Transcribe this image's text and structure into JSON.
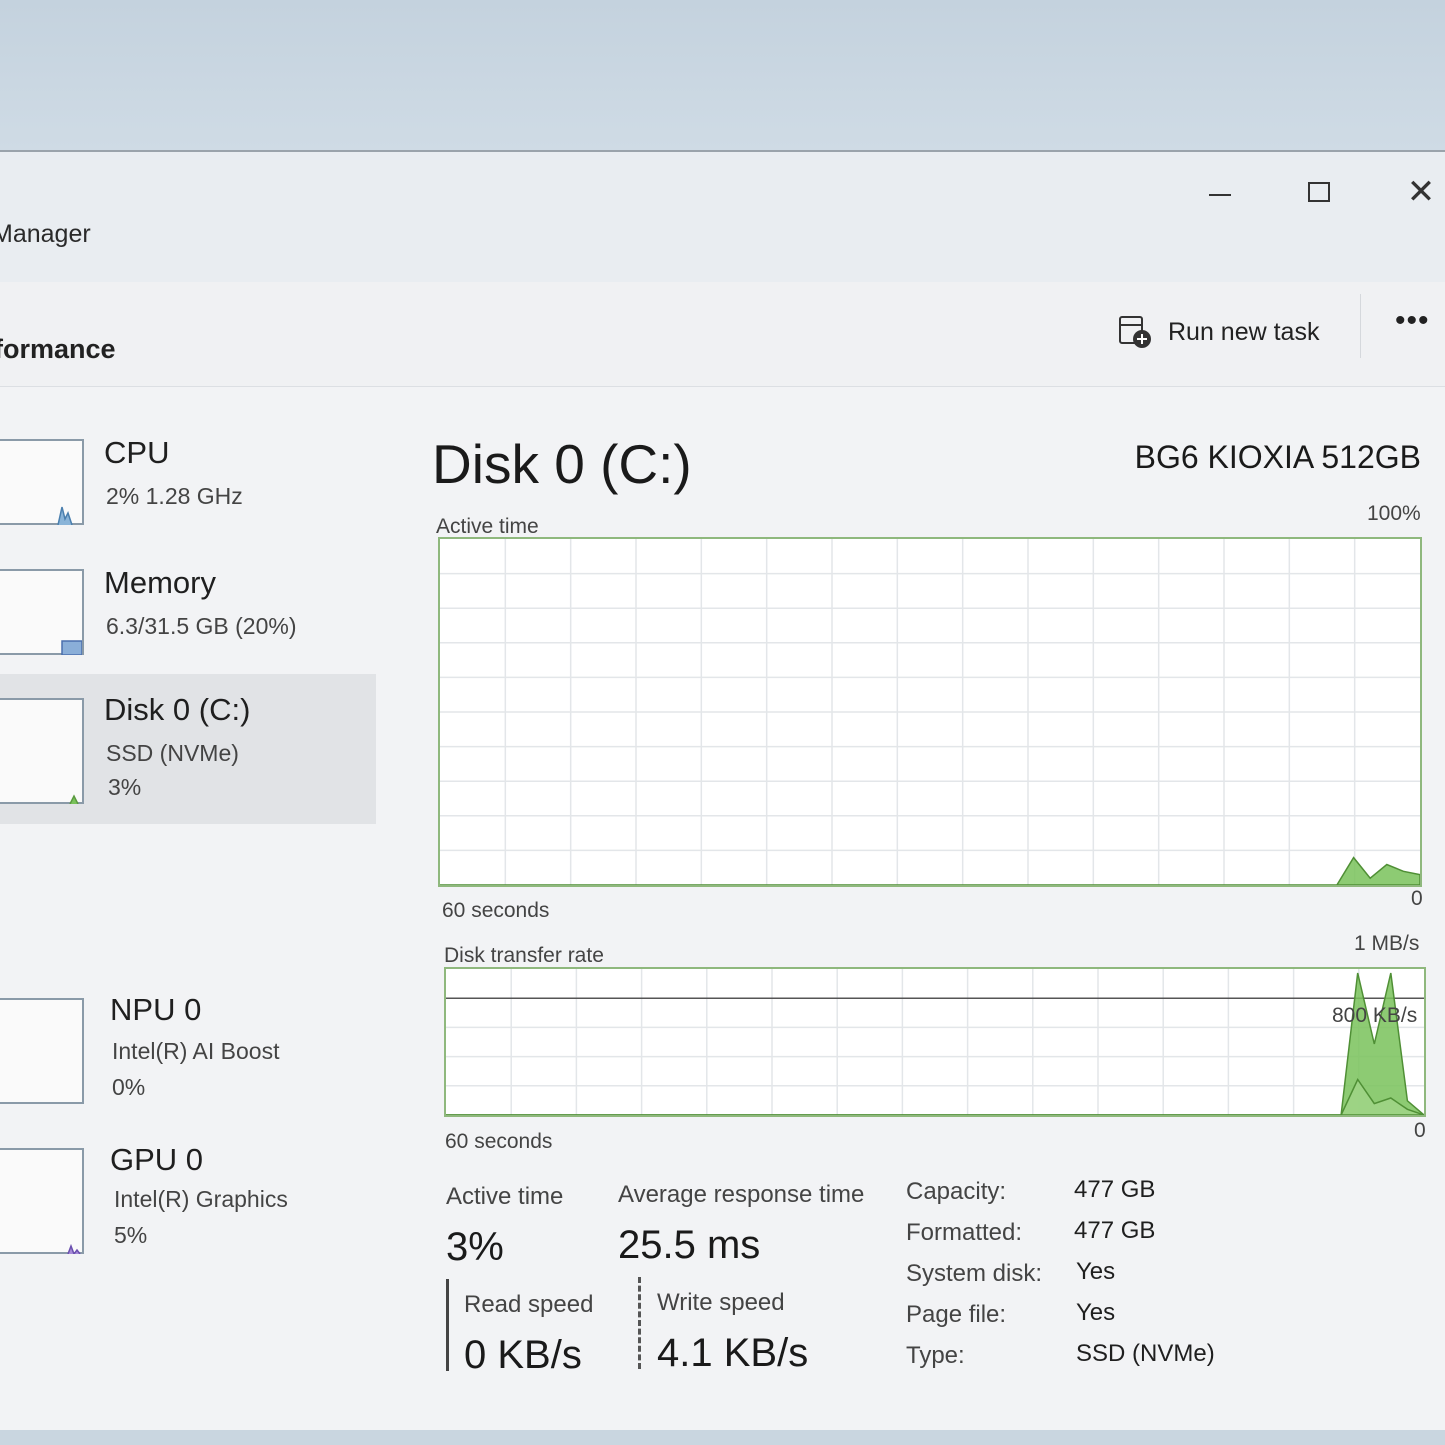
{
  "window": {
    "title": "Manager"
  },
  "header": {
    "page_title": "formance",
    "run_new_task_label": "Run new task",
    "more_label": "•••"
  },
  "sidebar": {
    "items": [
      {
        "name": "CPU",
        "sub": "2%  1.28 GHz",
        "sub2": ""
      },
      {
        "name": "Memory",
        "sub": "6.3/31.5 GB (20%)",
        "sub2": ""
      },
      {
        "name": "Disk 0 (C:)",
        "sub": "SSD (NVMe)",
        "sub2": "3%"
      },
      {
        "name": "NPU 0",
        "sub": "Intel(R) AI Boost",
        "sub2": "0%"
      },
      {
        "name": "GPU 0",
        "sub": "Intel(R) Graphics",
        "sub2": "5%"
      }
    ]
  },
  "main": {
    "title": "Disk 0 (C:)",
    "model": "BG6 KIOXIA 512GB",
    "active_graph": {
      "label": "Active time",
      "max_label": "100%",
      "time_label": "60 seconds",
      "min_label": "0"
    },
    "transfer_graph": {
      "label": "Disk transfer rate",
      "max_label": "1 MB/s",
      "mid_label": "800 KB/s",
      "time_label": "60 seconds",
      "min_label": "0"
    },
    "stats": {
      "active_time_label": "Active time",
      "active_time_value": "3%",
      "avg_response_label": "Average response time",
      "avg_response_value": "25.5 ms",
      "read_label": "Read speed",
      "read_value": "0 KB/s",
      "write_label": "Write speed",
      "write_value": "4.1 KB/s"
    },
    "properties": [
      {
        "key": "Capacity:",
        "value": "477 GB"
      },
      {
        "key": "Formatted:",
        "value": "477 GB"
      },
      {
        "key": "System disk:",
        "value": "Yes"
      },
      {
        "key": "Page file:",
        "value": "Yes"
      },
      {
        "key": "Type:",
        "value": "SSD (NVMe)"
      }
    ]
  },
  "chart_data": [
    {
      "type": "area",
      "title": "Active time",
      "ylim": [
        0,
        100
      ],
      "unit": "%",
      "x_span": "60 seconds",
      "series": [
        {
          "values": [
            0,
            0,
            0,
            0,
            0,
            0,
            0,
            0,
            0,
            0,
            0,
            0,
            0,
            0,
            0,
            0,
            0,
            0,
            0,
            0,
            0,
            0,
            0,
            0,
            0,
            0,
            0,
            0,
            0,
            0,
            0,
            0,
            0,
            0,
            0,
            0,
            0,
            0,
            0,
            0,
            0,
            0,
            0,
            0,
            0,
            0,
            0,
            0,
            0,
            0,
            0,
            0,
            0,
            0,
            0,
            8,
            2,
            6,
            4,
            3
          ]
        }
      ],
      "grid": true,
      "color": "#79c25a"
    },
    {
      "type": "area",
      "title": "Disk transfer rate",
      "ylim": [
        0,
        1000
      ],
      "unit": "KB/s",
      "x_span": "60 seconds",
      "series": [
        {
          "values": [
            0,
            0,
            0,
            0,
            0,
            0,
            0,
            0,
            0,
            0,
            0,
            0,
            0,
            0,
            0,
            0,
            0,
            0,
            0,
            0,
            0,
            0,
            0,
            0,
            0,
            0,
            0,
            0,
            0,
            0,
            0,
            0,
            0,
            0,
            0,
            0,
            0,
            0,
            0,
            0,
            0,
            0,
            0,
            0,
            0,
            0,
            0,
            0,
            0,
            0,
            0,
            0,
            0,
            0,
            0,
            1000,
            500,
            1000,
            100,
            0
          ]
        },
        {
          "values": [
            0,
            0,
            0,
            0,
            0,
            0,
            0,
            0,
            0,
            0,
            0,
            0,
            0,
            0,
            0,
            0,
            0,
            0,
            0,
            0,
            0,
            0,
            0,
            0,
            0,
            0,
            0,
            0,
            0,
            0,
            0,
            0,
            0,
            0,
            0,
            0,
            0,
            0,
            0,
            0,
            0,
            0,
            0,
            0,
            0,
            0,
            0,
            0,
            0,
            0,
            0,
            0,
            0,
            0,
            0,
            250,
            80,
            120,
            40,
            0
          ]
        }
      ],
      "grid": true,
      "color": "#79c25a"
    }
  ]
}
